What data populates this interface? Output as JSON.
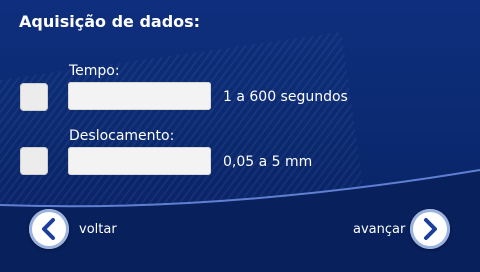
{
  "title": "Aquisição de dados:",
  "fields": [
    {
      "label": "Tempo:",
      "value": "",
      "unit": "1 a 600 segundos"
    },
    {
      "label": "Deslocamento:",
      "value": "",
      "unit": "0,05 a 5 mm"
    }
  ],
  "navigation": {
    "back_label": "voltar",
    "next_label": "avançar"
  },
  "colors": {
    "background": "#0b2a72",
    "accent_blue": "#1b3f9b"
  }
}
